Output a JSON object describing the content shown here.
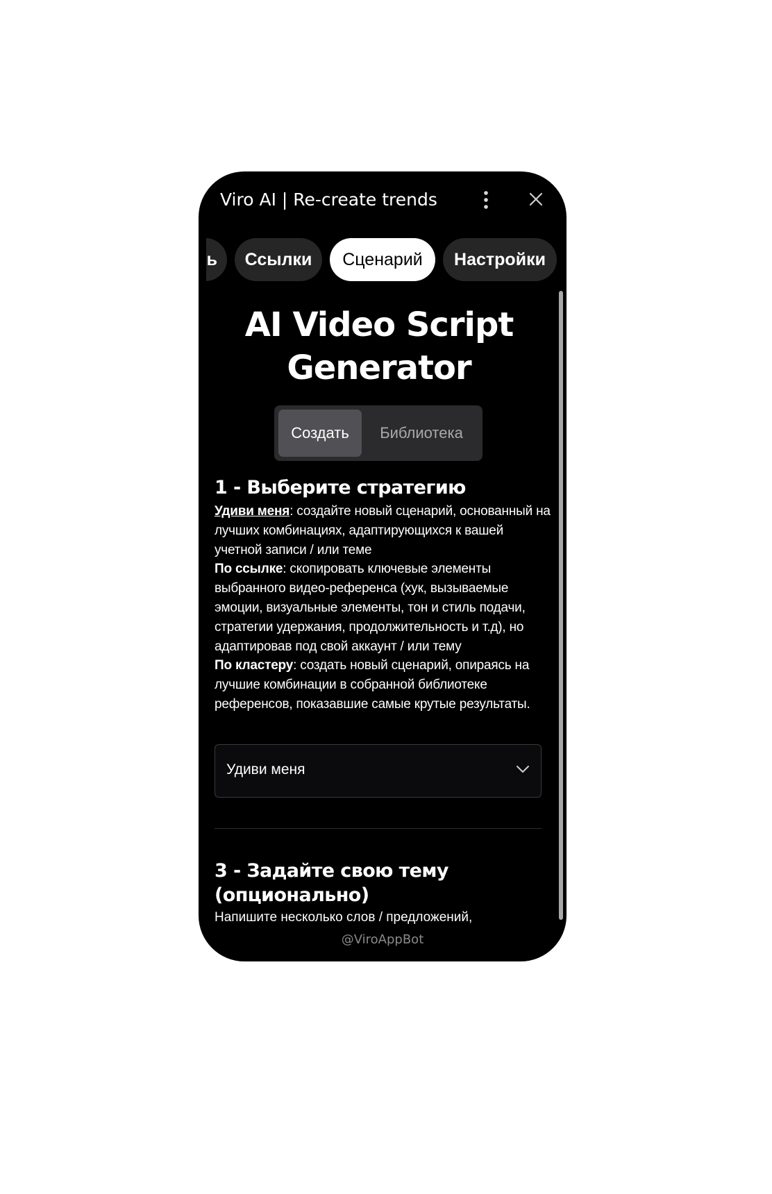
{
  "header": {
    "title": "Viro AI | Re-create trends",
    "menu_icon": "more-vertical-icon",
    "close_icon": "close-icon"
  },
  "tabs": [
    {
      "label": "ь",
      "active": false
    },
    {
      "label": "Ссылки",
      "active": false
    },
    {
      "label": "Сценарий",
      "active": true
    },
    {
      "label": "Настройки",
      "active": false
    }
  ],
  "hero": {
    "title_line1": "AI Video Script",
    "title_line2": "Generator"
  },
  "segmented": {
    "create": "Создать",
    "library": "Библиотека",
    "selected": "Создать"
  },
  "section1": {
    "heading": "1 - Выберите стратегию",
    "surprise_label": "Удиви меня",
    "surprise_text": ": создайте новый сценарий, основанный на лучших комбинациях, адаптирующихся к вашей учетной записи / или теме",
    "link_label": "По ссылке",
    "link_text": ": скопировать ключевые элементы выбранного видео-референса (хук, вызываемые эмоции, визуальные элементы, тон и стиль подачи, стратегии удержания, продолжительность и т.д), но адаптировав под свой аккаунт / или тему",
    "cluster_label": "По кластеру",
    "cluster_text": ": создать новый сценарий, опираясь на лучшие комбинации в собранной библиотеке референсов, показавшие самые крутые результаты."
  },
  "strategy_select": {
    "value": "Удиви меня",
    "icon": "chevron-down-icon"
  },
  "section3": {
    "heading": "3 - Задайте свою тему (опционально)",
    "description": "Напишите несколько слов / предложений,"
  },
  "footer": {
    "bot_handle": "@ViroAppBot"
  },
  "colors": {
    "background": "#000000",
    "tab_inactive": "#262626",
    "tab_active": "#ffffff",
    "segmented_bg": "#2b2b2d",
    "segmented_active": "#515155"
  }
}
